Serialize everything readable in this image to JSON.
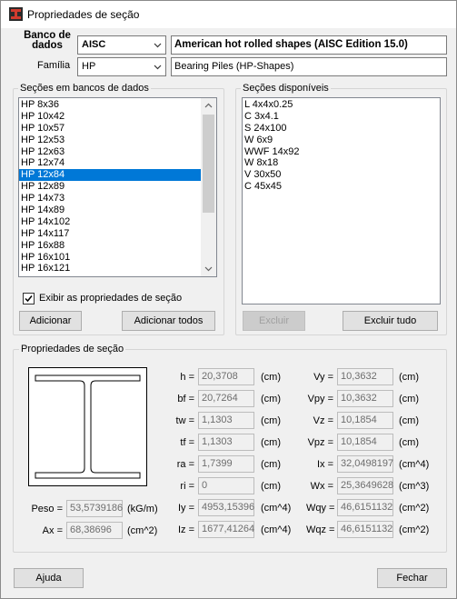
{
  "window": {
    "title": "Propriedades de seção"
  },
  "database": {
    "label": "Banco de dados",
    "value": "AISC",
    "description": "American hot rolled shapes (AISC Edition 15.0)"
  },
  "family": {
    "label": "Família",
    "value": "HP",
    "description": "Bearing Piles (HP-Shapes)"
  },
  "db_sections": {
    "title": "Seções em bancos de dados",
    "items": [
      "HP 8x36",
      "HP 10x42",
      "HP 10x57",
      "HP 12x53",
      "HP 12x63",
      "HP 12x74",
      "HP 12x84",
      "HP 12x89",
      "HP 14x73",
      "HP 14x89",
      "HP 14x102",
      "HP 14x117",
      "HP 16x88",
      "HP 16x101",
      "HP 16x121"
    ],
    "selected_index": 6
  },
  "available_sections": {
    "title": "Seções disponíveis",
    "items": [
      "L 4x4x0.25",
      "C 3x4.1",
      "S 24x100",
      "W 6x9",
      "WWF 14x92",
      "W 8x18",
      "V 30x50",
      "C 45x45"
    ]
  },
  "show_props": {
    "label": "Exibir as propriedades de seção",
    "checked": true
  },
  "buttons": {
    "add": "Adicionar",
    "add_all": "Adicionar todos",
    "remove": "Excluir",
    "remove_all": "Excluir tudo",
    "help": "Ajuda",
    "close": "Fechar"
  },
  "props": {
    "title": "Propriedades de seção",
    "peso": {
      "label": "Peso =",
      "value": "53,5739186",
      "unit": "(kG/m)"
    },
    "ax": {
      "label": "Ax =",
      "value": "68,38696",
      "unit": "(cm^2)"
    },
    "col1": [
      {
        "label": "h =",
        "value": "20,3708",
        "unit": "(cm)"
      },
      {
        "label": "bf =",
        "value": "20,7264",
        "unit": "(cm)"
      },
      {
        "label": "tw =",
        "value": "1,1303",
        "unit": "(cm)"
      },
      {
        "label": "tf =",
        "value": "1,1303",
        "unit": "(cm)"
      },
      {
        "label": "ra =",
        "value": "1,7399",
        "unit": "(cm)"
      },
      {
        "label": "ri =",
        "value": "0",
        "unit": "(cm)"
      },
      {
        "label": "Iy =",
        "value": "4953,15396",
        "unit": "(cm^4)"
      },
      {
        "label": "Iz =",
        "value": "1677,41264",
        "unit": "(cm^4)"
      }
    ],
    "col2": [
      {
        "label": "Vy =",
        "value": "10,3632",
        "unit": "(cm)"
      },
      {
        "label": "Vpy =",
        "value": "10,3632",
        "unit": "(cm)"
      },
      {
        "label": "Vz =",
        "value": "10,1854",
        "unit": "(cm)"
      },
      {
        "label": "Vpz =",
        "value": "10,1854",
        "unit": "(cm)"
      },
      {
        "label": "Ix =",
        "value": "32,0498197",
        "unit": "(cm^4)"
      },
      {
        "label": "Wx =",
        "value": "25,3649628",
        "unit": "(cm^3)"
      },
      {
        "label": "Wqy =",
        "value": "46,6151132",
        "unit": "(cm^2)"
      },
      {
        "label": "Wqz =",
        "value": "46,6151132",
        "unit": "(cm^2)"
      }
    ]
  }
}
